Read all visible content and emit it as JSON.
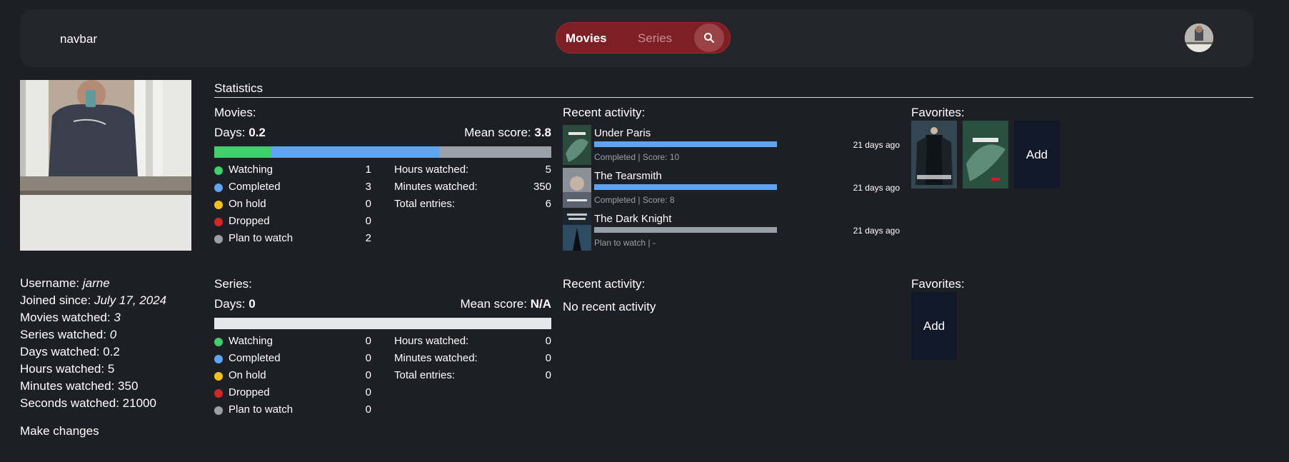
{
  "navbar": {
    "label": "navbar",
    "toggle_movies": "Movies",
    "toggle_series": "Series",
    "search_icon": "search-icon",
    "avatar_icon": "avatar"
  },
  "profile": {
    "username_label": "Username:",
    "username": "jarne",
    "joined_label": "Joined since:",
    "joined": "July 17, 2024",
    "movies_watched_label": "Movies watched:",
    "movies_watched": "3",
    "series_watched_label": "Series watched:",
    "series_watched": "0",
    "days_watched_label": "Days watched:",
    "days_watched": "0.2",
    "hours_watched_label": "Hours watched:",
    "hours_watched": "5",
    "minutes_watched_label": "Minutes watched:",
    "minutes_watched": "350",
    "seconds_watched_label": "Seconds watched:",
    "seconds_watched": "21000",
    "make_changes": "Make changes"
  },
  "statistics": {
    "title": "Statistics",
    "colors": {
      "watching": "#3fcf6c",
      "completed": "#5ea4f0",
      "on_hold": "#f2c21b",
      "dropped": "#d32626",
      "plan_to_watch": "#9aa0a8",
      "empty": "#e5e7eb"
    },
    "movies": {
      "label": "Movies:",
      "days_label": "Days:",
      "days": "0.2",
      "mean_label": "Mean score:",
      "mean": "3.8",
      "bar_fractions": {
        "watching": 0.1667,
        "completed": 0.5,
        "plan_to_watch": 0.3333
      },
      "status": [
        {
          "name": "Watching",
          "value": "1"
        },
        {
          "name": "Completed",
          "value": "3"
        },
        {
          "name": "On hold",
          "value": "0"
        },
        {
          "name": "Dropped",
          "value": "0"
        },
        {
          "name": "Plan to watch",
          "value": "2"
        }
      ],
      "totals": [
        {
          "name": "Hours watched:",
          "value": "5"
        },
        {
          "name": "Minutes watched:",
          "value": "350"
        },
        {
          "name": "Total entries:",
          "value": "6"
        }
      ],
      "recent_label": "Recent activity:",
      "recent": [
        {
          "title": "Under Paris",
          "status": "Completed",
          "score": "Score: 10",
          "time": "21 days ago",
          "progress": 1.0,
          "color": "#5ea4f0"
        },
        {
          "title": "The Tearsmith",
          "status": "Completed",
          "score": "Score: 8",
          "time": "21 days ago",
          "progress": 1.0,
          "color": "#5ea4f0"
        },
        {
          "title": "The Dark Knight",
          "status": "Plan to watch",
          "score": "-",
          "time": "21 days ago",
          "progress": 1.0,
          "color": "#9aa0a8"
        }
      ],
      "favorites_label": "Favorites:",
      "add_label": "Add"
    },
    "series": {
      "label": "Series:",
      "days_label": "Days:",
      "days": "0",
      "mean_label": "Mean score:",
      "mean": "N/A",
      "status": [
        {
          "name": "Watching",
          "value": "0"
        },
        {
          "name": "Completed",
          "value": "0"
        },
        {
          "name": "On hold",
          "value": "0"
        },
        {
          "name": "Dropped",
          "value": "0"
        },
        {
          "name": "Plan to watch",
          "value": "0"
        }
      ],
      "totals": [
        {
          "name": "Hours watched:",
          "value": "0"
        },
        {
          "name": "Minutes watched:",
          "value": "0"
        },
        {
          "name": "Total entries:",
          "value": "0"
        }
      ],
      "recent_label": "Recent activity:",
      "no_activity": "No recent activity",
      "favorites_label": "Favorites:",
      "add_label": "Add"
    }
  }
}
